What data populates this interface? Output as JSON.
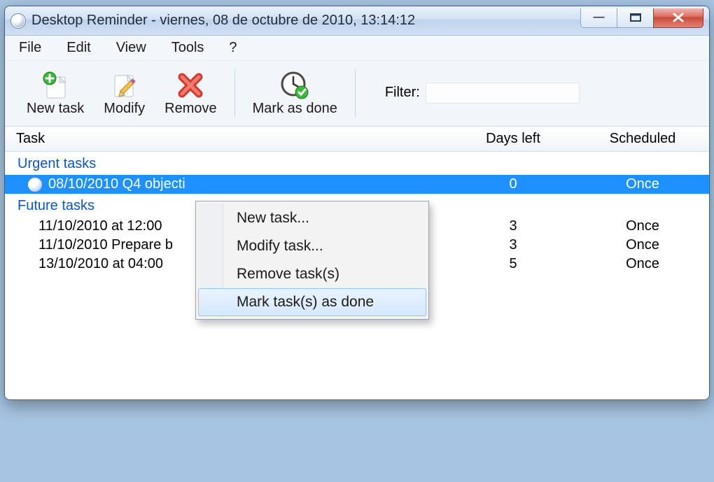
{
  "window": {
    "title": "Desktop Reminder - viernes, 08 de octubre de 2010, 13:14:12"
  },
  "menubar": {
    "file": "File",
    "edit": "Edit",
    "view": "View",
    "tools": "Tools",
    "help": "?"
  },
  "toolbar": {
    "new_task": "New task",
    "modify": "Modify",
    "remove": "Remove",
    "mark_done": "Mark as done",
    "filter_label": "Filter:",
    "filter_value": ""
  },
  "columns": {
    "task": "Task",
    "days_left": "Days left",
    "scheduled": "Scheduled"
  },
  "groups": {
    "urgent": "Urgent tasks",
    "future": "Future tasks"
  },
  "tasks": {
    "urgent": [
      {
        "text": "08/10/2010 Q4 objecti",
        "days": "0",
        "sched": "Once"
      }
    ],
    "future": [
      {
        "text": "11/10/2010 at 12:00",
        "days": "3",
        "sched": "Once"
      },
      {
        "text": "11/10/2010 Prepare b",
        "days": "3",
        "sched": "Once"
      },
      {
        "text": "13/10/2010 at 04:00",
        "days": "5",
        "sched": "Once"
      }
    ]
  },
  "context_menu": {
    "new": "New task...",
    "modify": "Modify task...",
    "remove": "Remove task(s)",
    "mark_done": "Mark task(s) as done"
  },
  "winbuttons": {
    "min": "—",
    "max": "▭",
    "close": "X"
  }
}
